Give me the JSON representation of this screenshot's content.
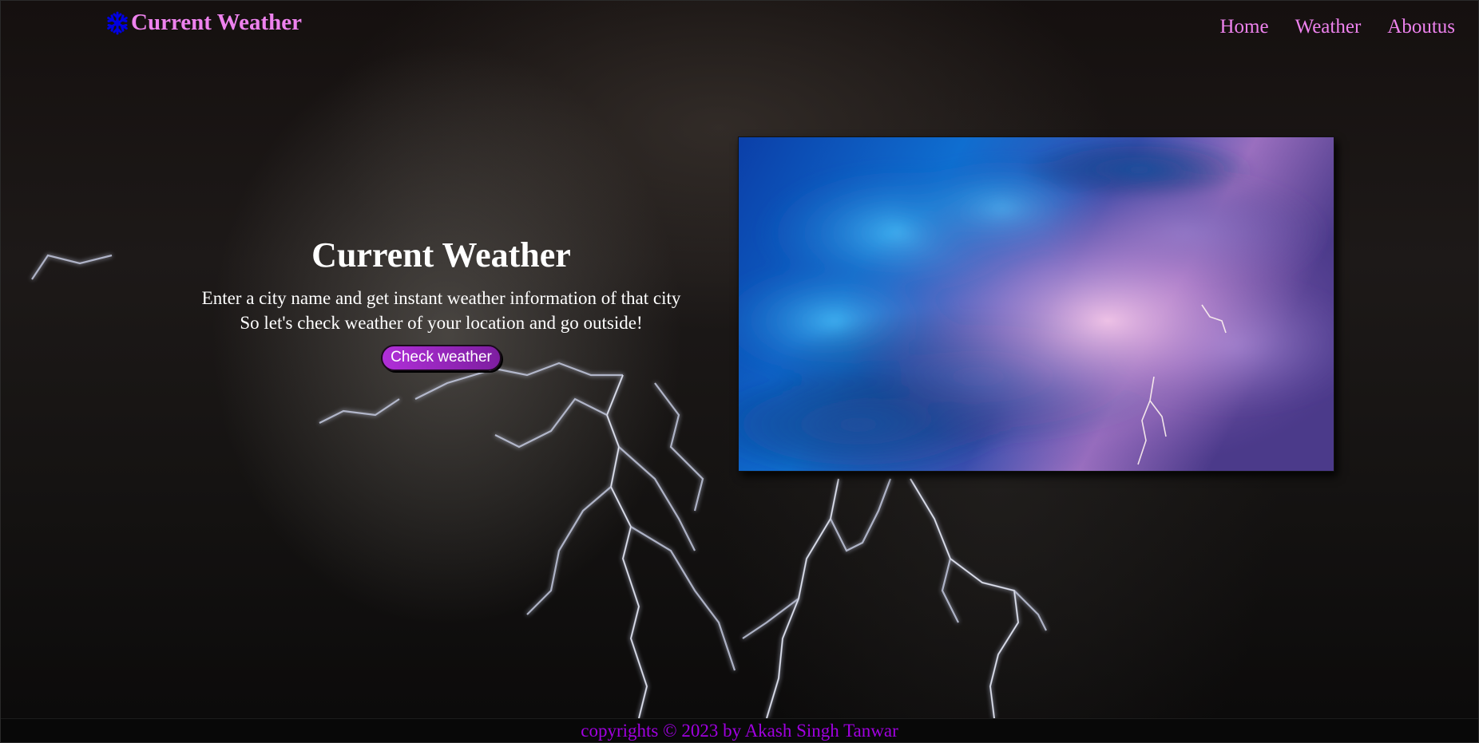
{
  "navbar": {
    "brand_icon": "snowflake-icon",
    "brand_icon_color": "#0000e0",
    "brand_text": "Current Weather",
    "links": [
      {
        "label": "Home"
      },
      {
        "label": "Weather"
      },
      {
        "label": "Aboutus"
      }
    ],
    "link_color": "#ee82ee"
  },
  "hero": {
    "title": "Current Weather",
    "line1": "Enter a city name and get instant weather information of that city",
    "line2": "So let's check weather of your location and go outside!",
    "button_label": "Check weather",
    "button_color": "#b02fd8"
  },
  "hero_image": {
    "subject": "storm-clouds-with-lightning"
  },
  "background": {
    "subject": "lightning-storm-night"
  },
  "footer": {
    "text": "copyrights © 2023 by Akash Singh Tanwar",
    "color": "#a000e0"
  }
}
